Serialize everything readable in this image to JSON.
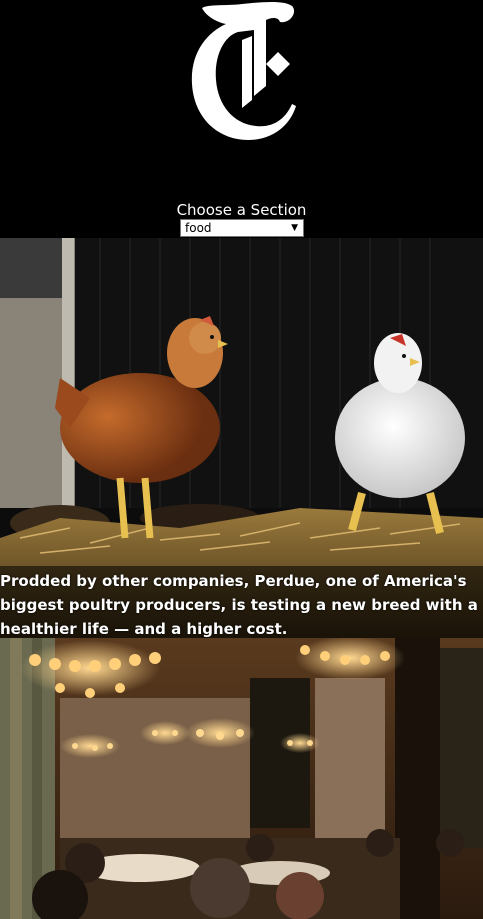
{
  "header": {
    "logo_icon": "nyt-t-logo-icon",
    "section_label": "Choose a Section",
    "section_select": {
      "value": "food"
    }
  },
  "stories": [
    {
      "image_icon": "chickens-photo",
      "caption": "Prodded by other companies, Perdue, one of America's biggest poultry producers, is testing a new breed with a healthier life — and a higher cost."
    },
    {
      "image_icon": "restaurant-dining-room-photo",
      "caption": ""
    }
  ],
  "colors": {
    "background": "#000000",
    "text": "#ffffff"
  }
}
